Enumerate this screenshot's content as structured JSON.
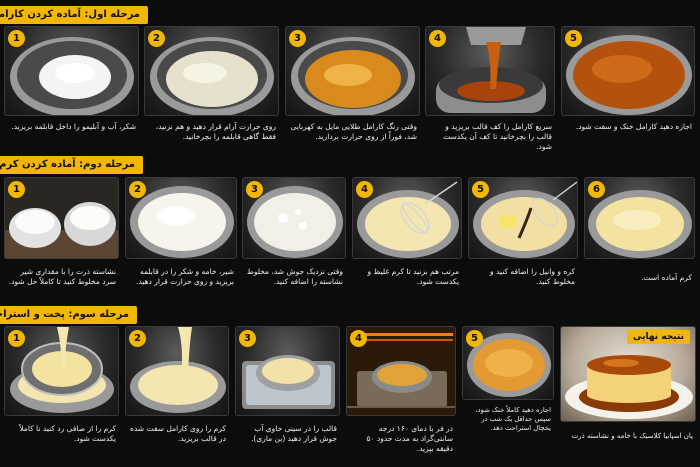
{
  "section1": {
    "title": "مرحله اول: آماده کردن کارامل",
    "steps": [
      {
        "num": "1",
        "caption": "شکر، آب و آبلیمو را داخل قابلمه بریزید."
      },
      {
        "num": "2",
        "caption": "روی حرارت آرام قرار دهید و هم نزنید، فقط گاهی قابلمه را بچرخانید."
      },
      {
        "num": "3",
        "caption": "وقتی رنگ کارامل طلایی مایل به کهربایی شد، فوراً از روی حرارت بردارید."
      },
      {
        "num": "4",
        "caption": "سریع کارامل را کف قالب بریزید و قالب را بچرخانید تا کف آن یکدست شود."
      },
      {
        "num": "5",
        "caption": "اجازه دهید کارامل خنک و سفت شود."
      }
    ]
  },
  "section2": {
    "title": "مرحله دوم: آماده کردن کرم",
    "steps": [
      {
        "num": "1",
        "caption": "نشاسته ذرت را با مقداری شیر سرد مخلوط کنید تا کاملاً حل شود."
      },
      {
        "num": "2",
        "caption": "شیر، خامه و شکر را در قابلمه بریزید و روی حرارت قرار دهید."
      },
      {
        "num": "3",
        "caption": "وقتی نزدیک جوش شد، مخلوط نشاسته را اضافه کنید."
      },
      {
        "num": "4",
        "caption": "مرتب هم بزنید تا کرم غلیظ و یکدست شود."
      },
      {
        "num": "5",
        "caption": "کره و وانیل را اضافه کنید و مخلوط کنید."
      },
      {
        "num": "6",
        "caption": "کرم آماده است."
      }
    ]
  },
  "section3": {
    "title": "مرحله سوم: پخت و استراحت",
    "steps": [
      {
        "num": "1",
        "caption": "کرم را از صافی رد کنید تا کاملاً یکدست شود."
      },
      {
        "num": "2",
        "caption": "کرم را روی کارامل سفت شده در قالب بریزید."
      },
      {
        "num": "3",
        "caption": "قالب را در سینی حاوی آب جوش قرار دهید (بن ماری)."
      },
      {
        "num": "4",
        "caption": "در فر با دمای ۱۶۰ درجه سانتی‌گراد به مدت حدود ۵۰ دقیقه بپزید."
      },
      {
        "num": "5",
        "caption": "اجازه دهید کاملاً خنک شود، سپس حداقل یک شب در یخچال استراحت دهد."
      }
    ],
    "result": {
      "label": "نتیجه نهایی",
      "caption": "پان اسپانیا کلاسیک با خامه و نشاسته ذرت"
    }
  },
  "colors": {
    "accent": "#f2b705",
    "background": "#0c0c0c",
    "caramel": "#c8600f",
    "cream": "#f3e6b0"
  }
}
